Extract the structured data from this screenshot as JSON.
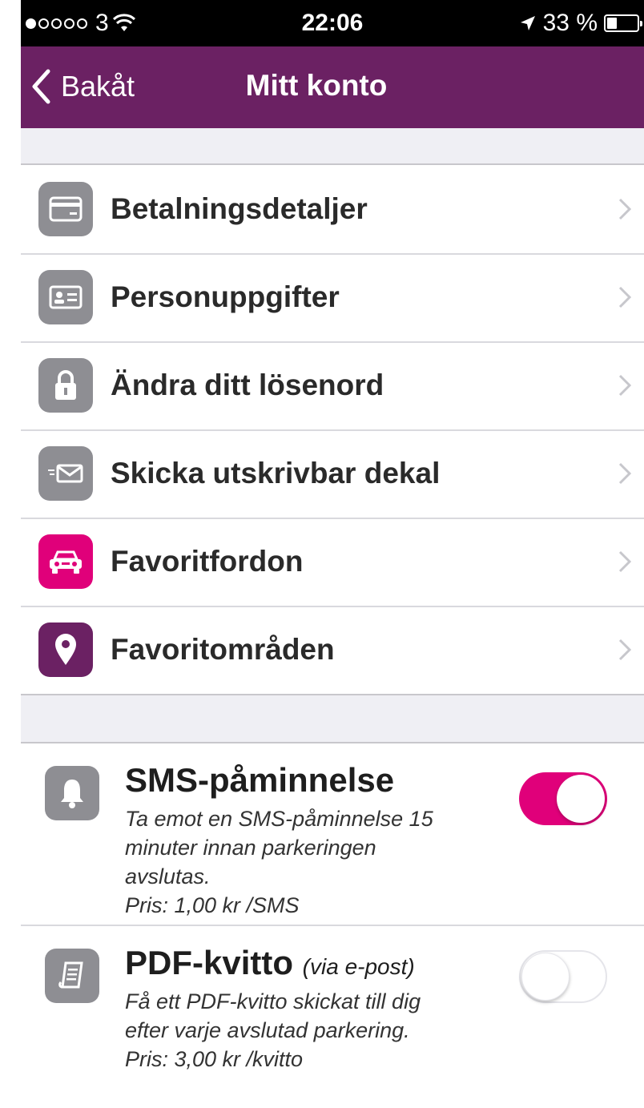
{
  "status_bar": {
    "carrier": "3",
    "time": "22:06",
    "battery_text": "33 %",
    "battery_level": 0.33,
    "signal_filled": 1,
    "signal_total": 5
  },
  "nav": {
    "back_label": "Bakåt",
    "title": "Mitt konto"
  },
  "menu": {
    "items": [
      {
        "label": "Betalningsdetaljer",
        "icon": "credit-card-icon",
        "color": "#8e8e93"
      },
      {
        "label": "Personuppgifter",
        "icon": "id-card-icon",
        "color": "#8e8e93"
      },
      {
        "label": "Ändra ditt lösenord",
        "icon": "lock-icon",
        "color": "#8e8e93"
      },
      {
        "label": "Skicka utskrivbar dekal",
        "icon": "envelope-icon",
        "color": "#8e8e93"
      },
      {
        "label": "Favoritfordon",
        "icon": "car-icon",
        "color": "#e0007a"
      },
      {
        "label": "Favoritområden",
        "icon": "location-pin-icon",
        "color": "#6b2163"
      }
    ]
  },
  "settings": {
    "sms": {
      "title": "SMS-påminnelse",
      "description": [
        "Ta emot en SMS-påminnelse 15",
        "minuter innan parkeringen",
        "avslutas.",
        "Pris: 1,00 kr /SMS"
      ],
      "enabled": true
    },
    "pdf": {
      "title": "PDF-kvitto",
      "title_suffix": "(via e-post)",
      "description": [
        "Få ett PDF-kvitto skickat till dig",
        "efter varje avslutad parkering.",
        "Pris: 3,00 kr /kvitto"
      ],
      "enabled": false
    }
  },
  "colors": {
    "nav_background": "#6b2163",
    "accent_pink": "#e0007a",
    "icon_gray": "#8e8e93"
  }
}
